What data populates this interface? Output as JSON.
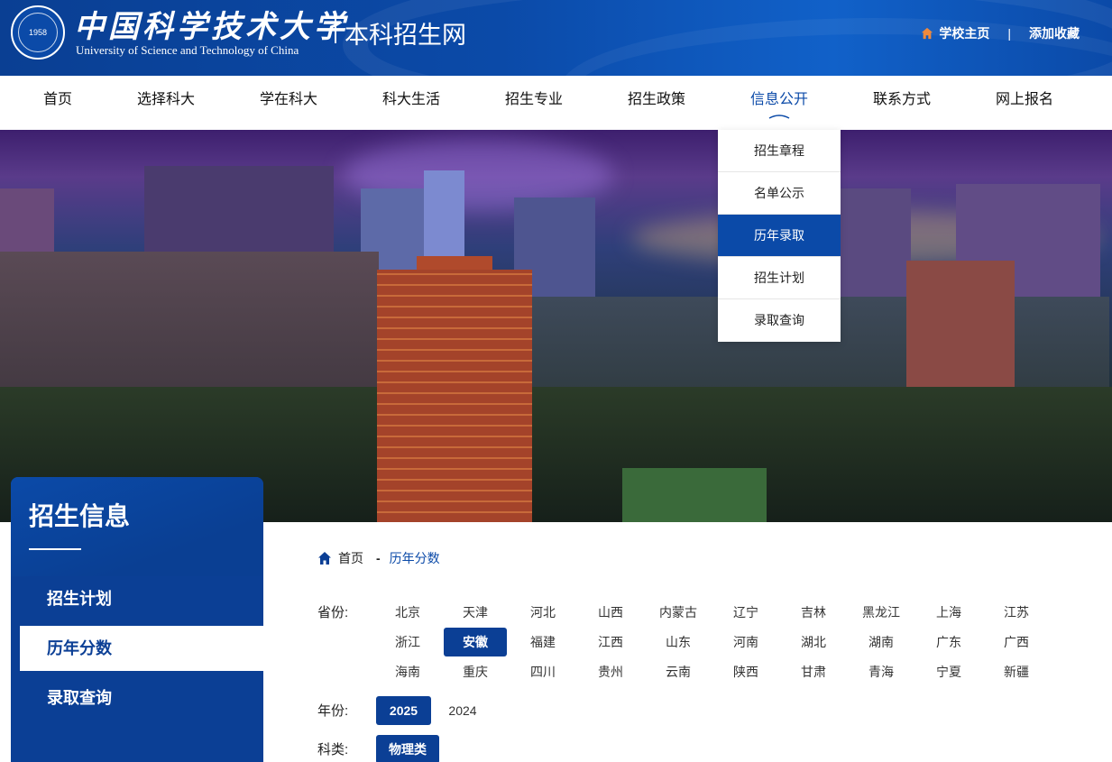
{
  "header": {
    "logo_cn": "中国科学技术大学",
    "logo_en": "University of Science and Technology of China",
    "seal_text": "1958",
    "subtitle": "本科招生网",
    "links": {
      "home": "学校主页",
      "divider": "|",
      "favorite": "添加收藏"
    }
  },
  "nav": {
    "items": [
      "首页",
      "选择科大",
      "学在科大",
      "科大生活",
      "招生专业",
      "招生政策",
      "信息公开",
      "联系方式",
      "网上报名"
    ],
    "active": "信息公开"
  },
  "dropdown": {
    "items": [
      "招生章程",
      "名单公示",
      "历年录取",
      "招生计划",
      "录取查询"
    ],
    "active": "历年录取"
  },
  "sidebar": {
    "title": "招生信息",
    "items": [
      "招生计划",
      "历年分数",
      "录取查询"
    ],
    "active": "历年分数"
  },
  "breadcrumb": {
    "home": "首页",
    "sep": "-",
    "current": "历年分数"
  },
  "filters": {
    "province_label": "省份:",
    "provinces": [
      [
        "北京",
        "天津",
        "河北",
        "山西",
        "内蒙古",
        "辽宁",
        "吉林",
        "黑龙江",
        "上海",
        "江苏"
      ],
      [
        "浙江",
        "安徽",
        "福建",
        "江西",
        "山东",
        "河南",
        "湖北",
        "湖南",
        "广东",
        "广西"
      ],
      [
        "海南",
        "重庆",
        "四川",
        "贵州",
        "云南",
        "陕西",
        "甘肃",
        "青海",
        "宁夏",
        "新疆"
      ]
    ],
    "active_province": "安徽",
    "year_label": "年份:",
    "years": [
      "2025",
      "2024"
    ],
    "active_year": "2025",
    "category_label": "科类:",
    "categories": [
      "物理类"
    ],
    "active_category": "物理类"
  },
  "colors": {
    "primary": "#0b3f95",
    "accent": "#0b4aa8",
    "home_icon": "#f08a3c"
  }
}
